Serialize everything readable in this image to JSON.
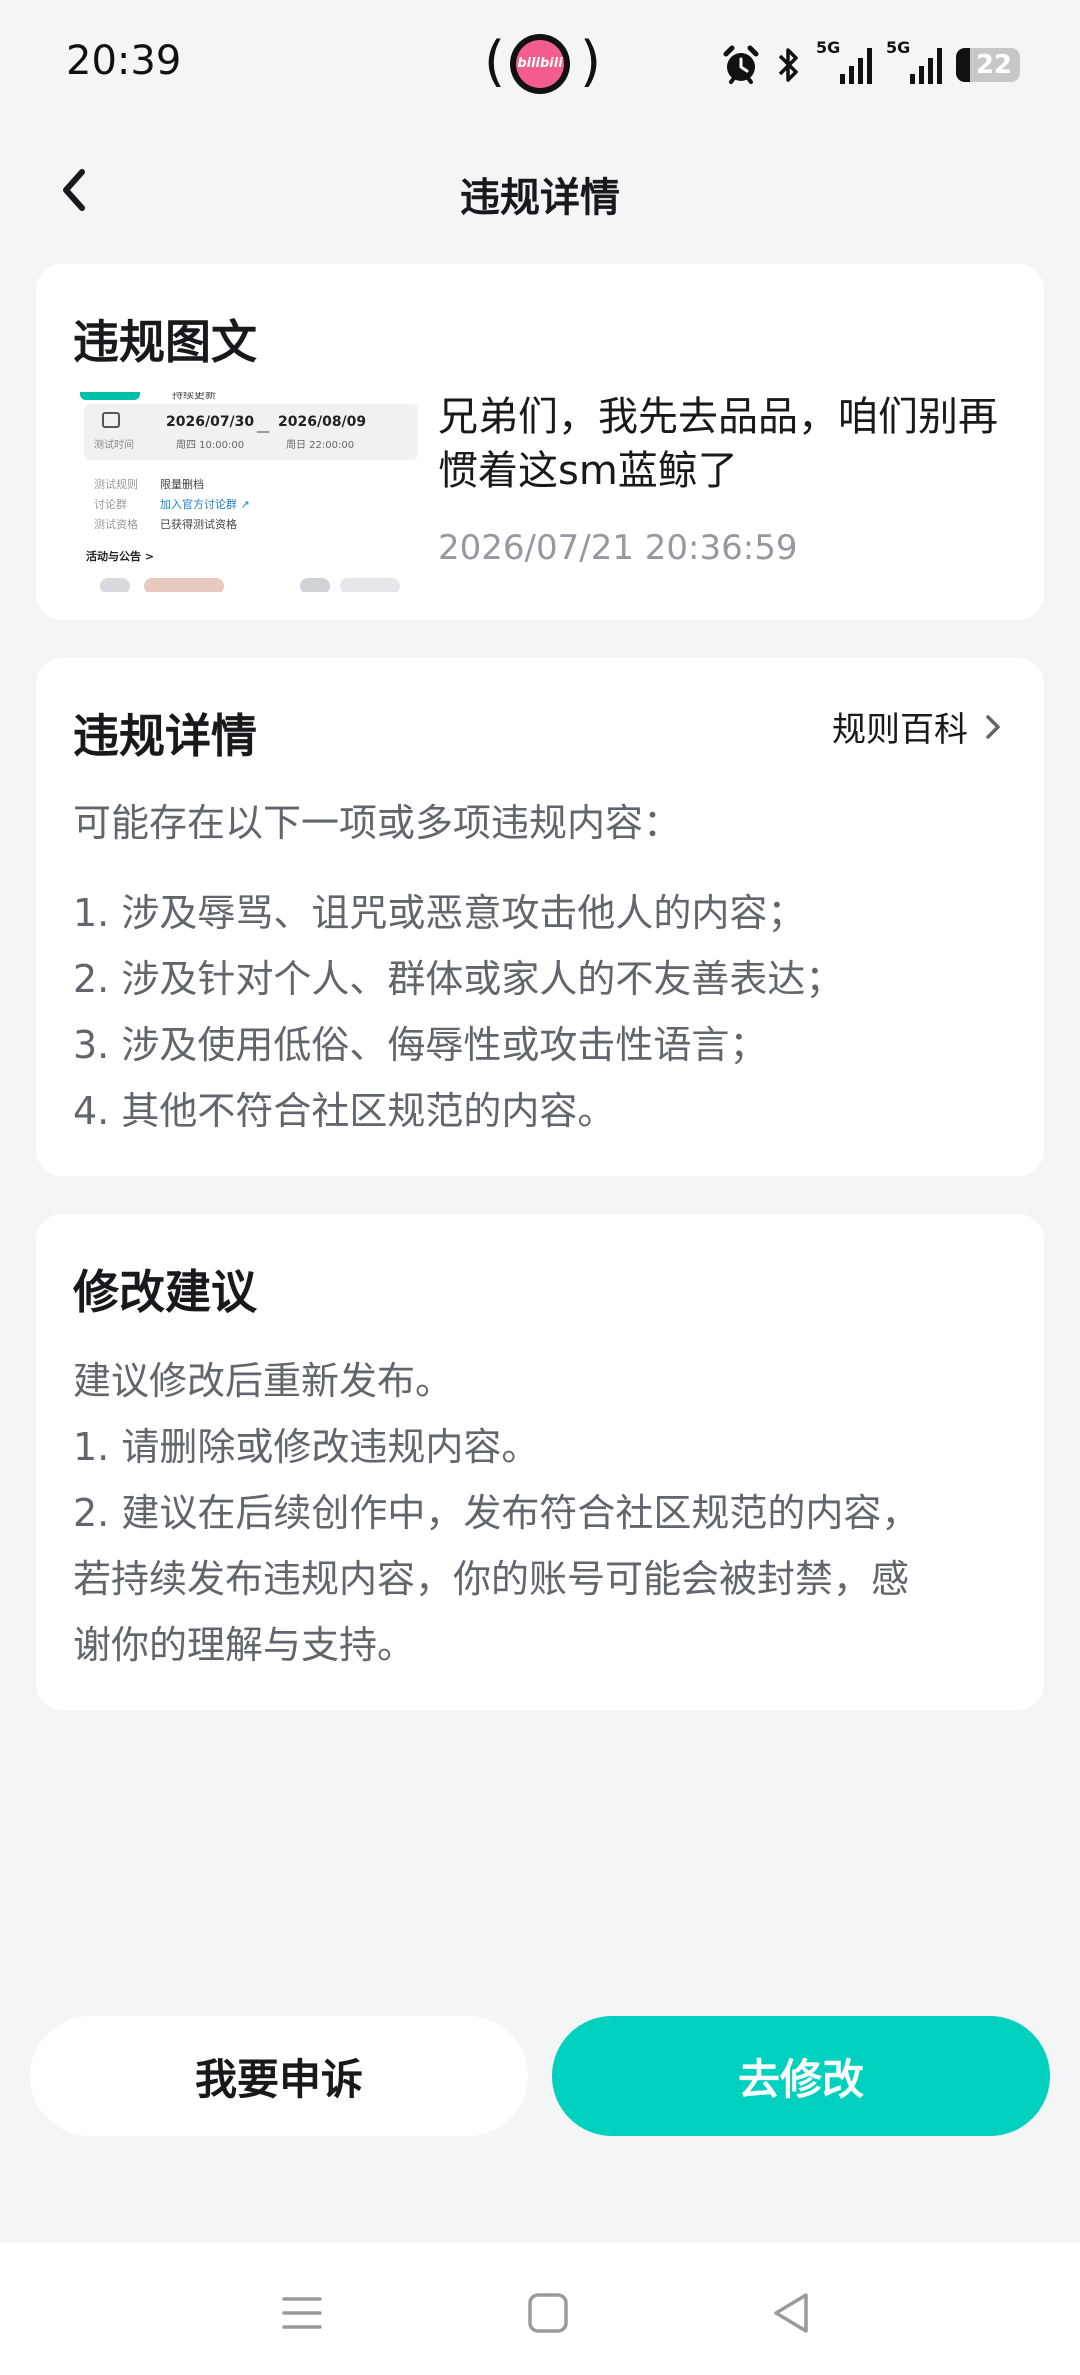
{
  "status_bar": {
    "time": "20:39",
    "app_badge": "bilibili",
    "net1": "5G",
    "net2": "5G",
    "battery": "22"
  },
  "nav": {
    "title": "违规详情"
  },
  "post_card": {
    "title": "违规图文",
    "text": "兄弟们，我先去品品，咱们别再惯着这sm蓝鲸了",
    "timestamp": "2026/07/21 20:36:59",
    "thumbnail": {
      "top_cut": "持续更新",
      "date_start": "2026/07/30",
      "time_start": "周四 10:00:00",
      "date_end": "2026/08/09",
      "time_end": "周日 22:00:00",
      "time_label": "测试时间",
      "rows": [
        {
          "key": "测试规则",
          "value": "限量删档"
        },
        {
          "key": "讨论群",
          "value": "加入官方讨论群 ↗"
        },
        {
          "key": "测试资格",
          "value": "已获得测试资格"
        }
      ],
      "activity": "活动与公告 >"
    }
  },
  "detail_card": {
    "title": "违规详情",
    "rules_link": "规则百科",
    "intro": "可能存在以下一项或多项违规内容：",
    "items": [
      "1. 涉及辱骂、诅咒或恶意攻击他人的内容；",
      "2. 涉及针对个人、群体或家人的不友善表达；",
      "3. 涉及使用低俗、侮辱性或攻击性语言；",
      "4. 其他不符合社区规范的内容。"
    ]
  },
  "suggest_card": {
    "title": "修改建议",
    "lines": [
      "建议修改后重新发布。",
      "1. 请删除或修改违规内容。",
      "2. 建议在后续创作中，发布符合社区规范的内容，",
      "若持续发布违规内容，你的账号可能会被封禁，感",
      "谢你的理解与支持。"
    ]
  },
  "actions": {
    "appeal": "我要申诉",
    "edit": "去修改"
  },
  "colors": {
    "accent": "#00d1bf",
    "background": "#f4f5f7",
    "text_secondary": "#61666d",
    "text_muted": "#9499a0"
  }
}
